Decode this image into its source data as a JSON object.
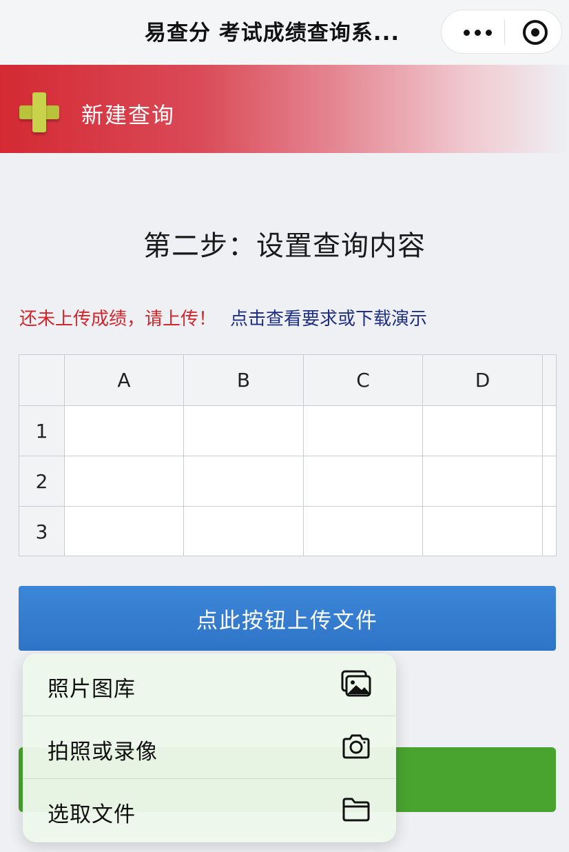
{
  "app": {
    "title": "易查分 考试成绩查询系..."
  },
  "capsule": {
    "more_icon": "more-dots-icon",
    "close_icon": "target-circle-icon"
  },
  "banner": {
    "label": "新建查询",
    "icon": "plus-icon"
  },
  "step": {
    "title": "第二步：设置查询内容"
  },
  "notice": {
    "warning": "还未上传成绩，请上传！",
    "link": "点击查看要求或下载演示"
  },
  "sheet": {
    "columns": [
      "A",
      "B",
      "C",
      "D"
    ],
    "rows": [
      "1",
      "2",
      "3"
    ]
  },
  "upload": {
    "button_label": "点此按钮上传文件"
  },
  "menu": {
    "items": [
      {
        "label": "照片图库",
        "icon": "photo-library-icon"
      },
      {
        "label": "拍照或录像",
        "icon": "camera-icon"
      },
      {
        "label": "选取文件",
        "icon": "folder-icon"
      }
    ]
  },
  "colors": {
    "banner_red": "#d42a34",
    "warning_red": "#d4252a",
    "link_blue": "#1f2f86",
    "upload_blue": "#2f74c8",
    "green": "#49a42f"
  }
}
